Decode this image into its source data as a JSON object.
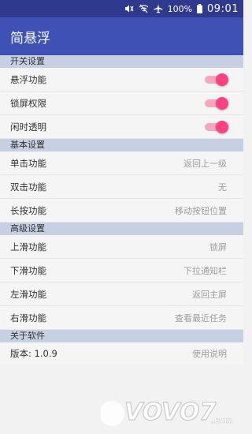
{
  "status": {
    "battery": "100%",
    "time": "09:01"
  },
  "app": {
    "title": "简悬浮"
  },
  "sections": {
    "switches": {
      "header": "开关设置",
      "items": [
        {
          "label": "悬浮功能",
          "on": true
        },
        {
          "label": "锁屏权限",
          "on": true
        },
        {
          "label": "闲时透明",
          "on": true
        }
      ]
    },
    "basic": {
      "header": "基本设置",
      "items": [
        {
          "label": "单击功能",
          "value": "返回上一级"
        },
        {
          "label": "双击功能",
          "value": "无"
        },
        {
          "label": "长按功能",
          "value": "移动按钮位置"
        }
      ]
    },
    "advanced": {
      "header": "高级设置",
      "items": [
        {
          "label": "上滑功能",
          "value": "锁屏"
        },
        {
          "label": "下滑功能",
          "value": "下拉通知栏"
        },
        {
          "label": "左滑功能",
          "value": "返回主屏"
        },
        {
          "label": "右滑功能",
          "value": "查看最近任务"
        }
      ]
    },
    "about": {
      "header": "关于软件",
      "version": "版本: 1.0.9",
      "help": "使用说明"
    }
  },
  "watermark": {
    "text": "VOVO7",
    "suffix": ".com"
  },
  "colors": {
    "statusbar": "#2f3a8f",
    "appbar": "#3f51b5",
    "accent": "#ff4081",
    "section_header": "#c7d0e2"
  }
}
